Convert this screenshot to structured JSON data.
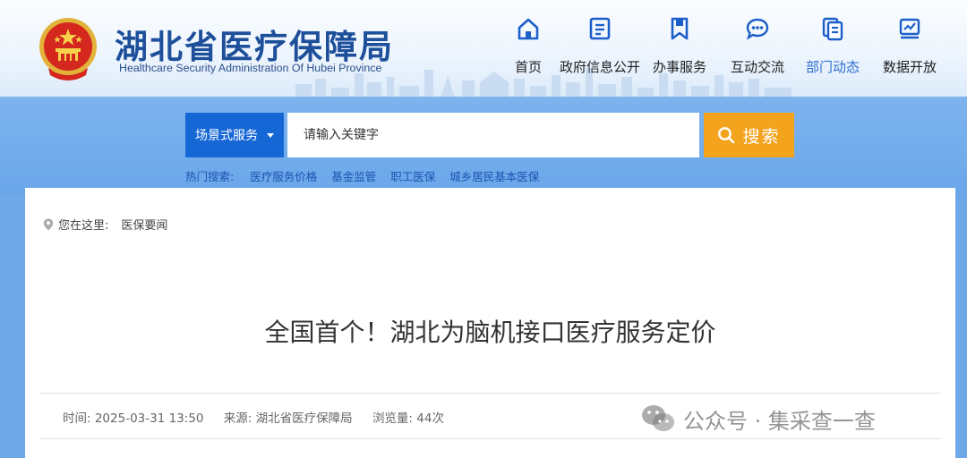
{
  "header": {
    "title": "湖北省医疗保障局",
    "subtitle": "Healthcare Security Administration Of Hubei Province",
    "emblem_icon": "national-emblem-icon"
  },
  "nav": [
    {
      "label": "首页",
      "icon": "home-icon",
      "active": false
    },
    {
      "label": "政府信息公开",
      "icon": "document-list-icon",
      "active": false
    },
    {
      "label": "办事服务",
      "icon": "bookmark-icon",
      "active": false
    },
    {
      "label": "互动交流",
      "icon": "chat-bubble-icon",
      "active": false
    },
    {
      "label": "部门动态",
      "icon": "copy-document-icon",
      "active": true
    },
    {
      "label": "数据开放",
      "icon": "chart-board-icon",
      "active": false
    }
  ],
  "search": {
    "scene_label": "场景式服务",
    "placeholder": "请输入关键字",
    "button_label": "搜索"
  },
  "hot_search": {
    "label": "热门搜索:",
    "items": [
      "医疗服务价格",
      "基金监管",
      "职工医保",
      "城乡居民基本医保"
    ]
  },
  "breadcrumb": {
    "prefix": "您在这里:",
    "current": "医保要闻"
  },
  "article": {
    "title": "全国首个！湖北为脑机接口医疗服务定价",
    "time": "时间: 2025-03-31 13:50",
    "source": "来源: 湖北省医疗保障局",
    "views": "浏览量: 44次"
  },
  "watermark": {
    "text": "公众号 · 集采查一查"
  },
  "colors": {
    "brand_blue": "#1e4f9a",
    "scene_button": "#1667d6",
    "search_button": "#f4a31d",
    "active_nav": "#2b6fd0"
  }
}
